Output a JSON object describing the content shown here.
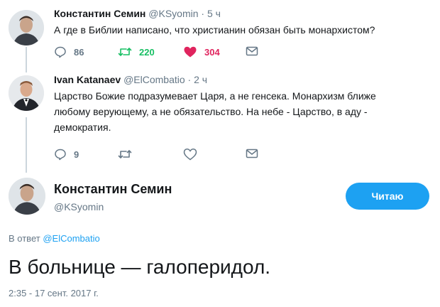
{
  "tweet1": {
    "name": "Константин Семин",
    "handle": "@KSyomin",
    "time": "5 ч",
    "text": "А где в Библии написано, что христианин обязан быть монархистом?",
    "reply_count": "86",
    "retweet_count": "220",
    "like_count": "304"
  },
  "tweet2": {
    "name": "Ivan Katanaev",
    "handle": "@ElCombatio",
    "time": "2 ч",
    "text_lines": [
      "Царство Божие подразумевает Царя, а не генсека. Монархизм ближе",
      "любому верующему, а не обязательство. На небе - Царство, в аду -",
      "демократия."
    ],
    "reply_count": "9"
  },
  "main_tweet": {
    "name": "Константин Семин",
    "handle": "@KSyomin",
    "follow_label": "Читаю",
    "reply_prefix": "В ответ",
    "reply_handle": "@ElCombatio",
    "text": "В больнице — галоперидол.",
    "timestamp": "2:35 - 17 сент. 2017 г."
  },
  "colors": {
    "accent": "#1da1f2",
    "retweet": "#17bf63",
    "like": "#e0245e",
    "secondary_text": "#657786"
  }
}
